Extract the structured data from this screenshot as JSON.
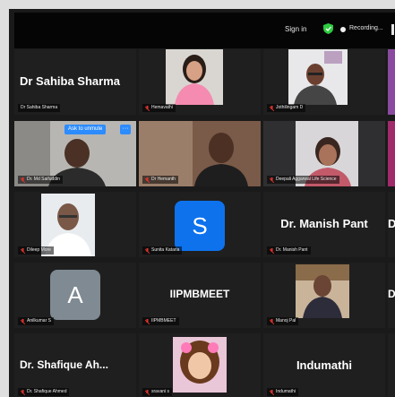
{
  "topbar": {
    "signin": "Sign in",
    "recording": "Recording..."
  },
  "colors": {
    "mic_muted": "#e0342e",
    "accent_blue": "#2d8cff",
    "shield_green": "#2ecc40"
  },
  "tiles": [
    {
      "name": "Dr Sahiba Sharma",
      "label": "Dr Sahiba Sharma"
    },
    {
      "label": "Hemavathi"
    },
    {
      "label": "Jothilingam D"
    },
    {
      "label": "Dr. Md Saifuddin",
      "ask": "Ask to unmute",
      "more": "···"
    },
    {
      "label": "Dr Hemanth"
    },
    {
      "label": "Deepali Aggarwal Life Science"
    },
    {
      "label": "Dileep More"
    },
    {
      "avatar": "S",
      "label": "Sunita Kataria"
    },
    {
      "name": "Dr. Manish Pant",
      "label": "Dr. Manish Pant"
    },
    {
      "avatar": "A",
      "label": "Anilkumar S"
    },
    {
      "name": "IIPMBMEET",
      "label": "IIPMBMEET"
    },
    {
      "label": "Manoj Pal"
    },
    {
      "name": "Dr. Shafique Ah...",
      "label": "Dr. Shafique Ahmed"
    },
    {
      "label": "sravani s"
    },
    {
      "name": "Indumathi",
      "label": "Indumathi"
    }
  ],
  "edge": {
    "row1": "D",
    "row2": "Dr"
  }
}
